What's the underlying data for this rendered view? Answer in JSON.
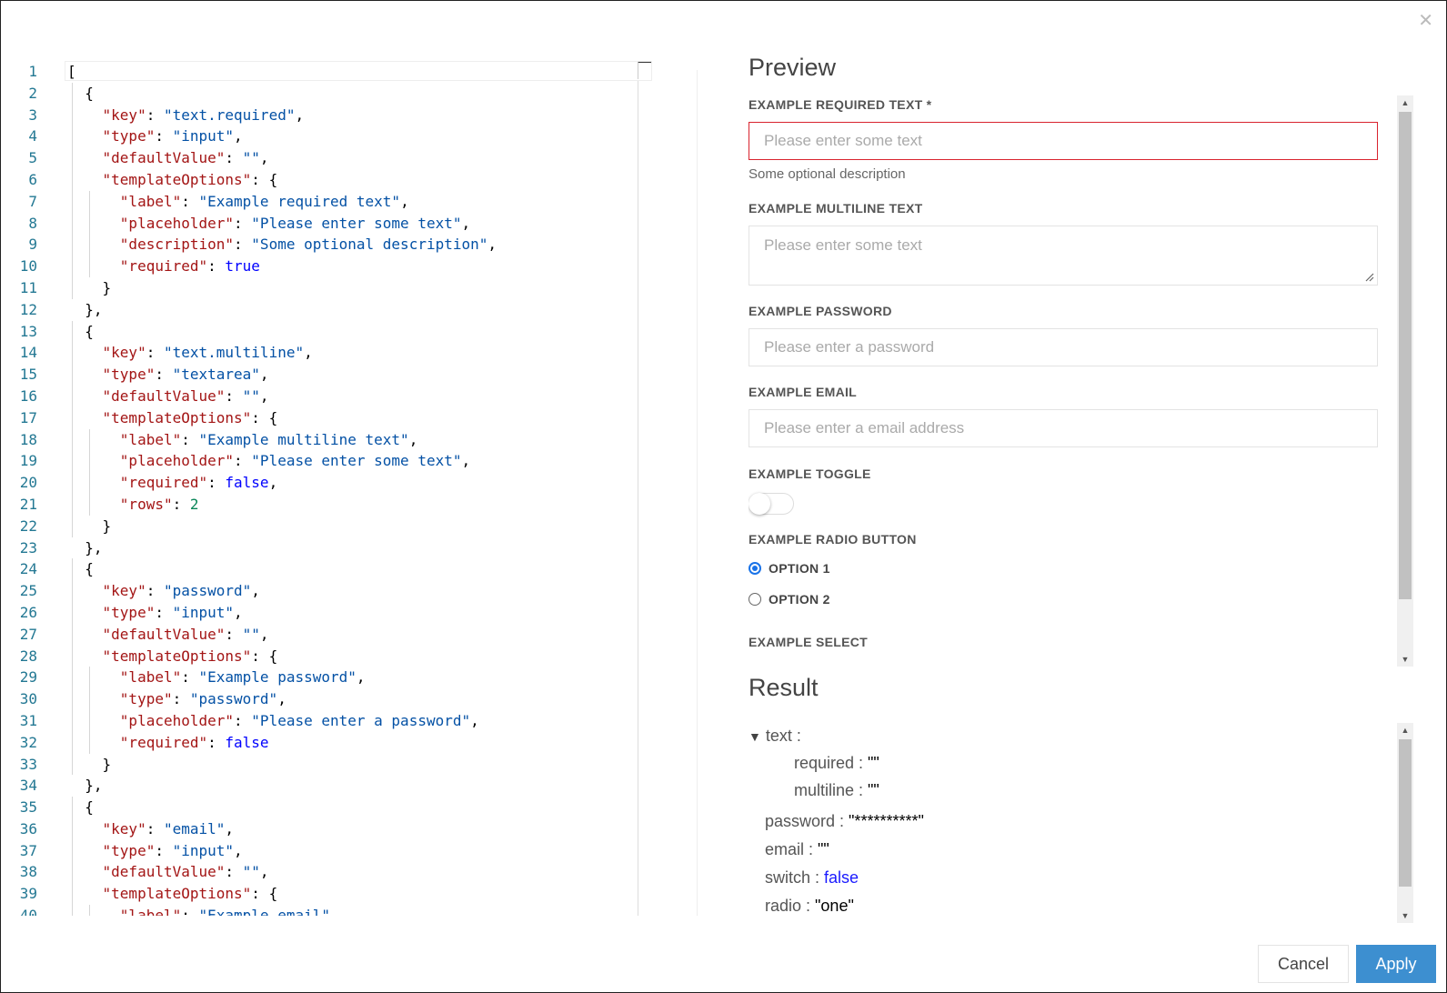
{
  "dialog": {
    "close_icon": "close-icon",
    "preview_title": "Preview",
    "result_title": "Result",
    "cancel_label": "Cancel",
    "apply_label": "Apply"
  },
  "editor": {
    "lines": [
      {
        "n": "1",
        "t": [
          [
            "p",
            "["
          ]
        ],
        "g": []
      },
      {
        "n": "2",
        "t": [
          [
            "p",
            "  {"
          ]
        ],
        "g": [
          0
        ]
      },
      {
        "n": "3",
        "t": [
          [
            "p",
            "    "
          ],
          [
            "k",
            "\"key\""
          ],
          [
            "p",
            ": "
          ],
          [
            "s",
            "\"text.required\""
          ],
          [
            "p",
            ","
          ]
        ],
        "g": [
          0
        ]
      },
      {
        "n": "4",
        "t": [
          [
            "p",
            "    "
          ],
          [
            "k",
            "\"type\""
          ],
          [
            "p",
            ": "
          ],
          [
            "s",
            "\"input\""
          ],
          [
            "p",
            ","
          ]
        ],
        "g": [
          0
        ]
      },
      {
        "n": "5",
        "t": [
          [
            "p",
            "    "
          ],
          [
            "k",
            "\"defaultValue\""
          ],
          [
            "p",
            ": "
          ],
          [
            "s",
            "\"\""
          ],
          [
            "p",
            ","
          ]
        ],
        "g": [
          0
        ]
      },
      {
        "n": "6",
        "t": [
          [
            "p",
            "    "
          ],
          [
            "k",
            "\"templateOptions\""
          ],
          [
            "p",
            ": {"
          ]
        ],
        "g": [
          0
        ]
      },
      {
        "n": "7",
        "t": [
          [
            "p",
            "      "
          ],
          [
            "k",
            "\"label\""
          ],
          [
            "p",
            ": "
          ],
          [
            "s",
            "\"Example required text\""
          ],
          [
            "p",
            ","
          ]
        ],
        "g": [
          0,
          1
        ]
      },
      {
        "n": "8",
        "t": [
          [
            "p",
            "      "
          ],
          [
            "k",
            "\"placeholder\""
          ],
          [
            "p",
            ": "
          ],
          [
            "s",
            "\"Please enter some text\""
          ],
          [
            "p",
            ","
          ]
        ],
        "g": [
          0,
          1
        ]
      },
      {
        "n": "9",
        "t": [
          [
            "p",
            "      "
          ],
          [
            "k",
            "\"description\""
          ],
          [
            "p",
            ": "
          ],
          [
            "s",
            "\"Some optional description\""
          ],
          [
            "p",
            ","
          ]
        ],
        "g": [
          0,
          1
        ]
      },
      {
        "n": "10",
        "t": [
          [
            "p",
            "      "
          ],
          [
            "k",
            "\"required\""
          ],
          [
            "p",
            ": "
          ],
          [
            "b",
            "true"
          ]
        ],
        "g": [
          0,
          1
        ]
      },
      {
        "n": "11",
        "t": [
          [
            "p",
            "    }"
          ]
        ],
        "g": [
          0
        ]
      },
      {
        "n": "12",
        "t": [
          [
            "p",
            "  },"
          ]
        ],
        "g": []
      },
      {
        "n": "13",
        "t": [
          [
            "p",
            "  {"
          ]
        ],
        "g": [
          0
        ]
      },
      {
        "n": "14",
        "t": [
          [
            "p",
            "    "
          ],
          [
            "k",
            "\"key\""
          ],
          [
            "p",
            ": "
          ],
          [
            "s",
            "\"text.multiline\""
          ],
          [
            "p",
            ","
          ]
        ],
        "g": [
          0
        ]
      },
      {
        "n": "15",
        "t": [
          [
            "p",
            "    "
          ],
          [
            "k",
            "\"type\""
          ],
          [
            "p",
            ": "
          ],
          [
            "s",
            "\"textarea\""
          ],
          [
            "p",
            ","
          ]
        ],
        "g": [
          0
        ]
      },
      {
        "n": "16",
        "t": [
          [
            "p",
            "    "
          ],
          [
            "k",
            "\"defaultValue\""
          ],
          [
            "p",
            ": "
          ],
          [
            "s",
            "\"\""
          ],
          [
            "p",
            ","
          ]
        ],
        "g": [
          0
        ]
      },
      {
        "n": "17",
        "t": [
          [
            "p",
            "    "
          ],
          [
            "k",
            "\"templateOptions\""
          ],
          [
            "p",
            ": {"
          ]
        ],
        "g": [
          0
        ]
      },
      {
        "n": "18",
        "t": [
          [
            "p",
            "      "
          ],
          [
            "k",
            "\"label\""
          ],
          [
            "p",
            ": "
          ],
          [
            "s",
            "\"Example multiline text\""
          ],
          [
            "p",
            ","
          ]
        ],
        "g": [
          0,
          1
        ]
      },
      {
        "n": "19",
        "t": [
          [
            "p",
            "      "
          ],
          [
            "k",
            "\"placeholder\""
          ],
          [
            "p",
            ": "
          ],
          [
            "s",
            "\"Please enter some text\""
          ],
          [
            "p",
            ","
          ]
        ],
        "g": [
          0,
          1
        ]
      },
      {
        "n": "20",
        "t": [
          [
            "p",
            "      "
          ],
          [
            "k",
            "\"required\""
          ],
          [
            "p",
            ": "
          ],
          [
            "b",
            "false"
          ],
          [
            "p",
            ","
          ]
        ],
        "g": [
          0,
          1
        ]
      },
      {
        "n": "21",
        "t": [
          [
            "p",
            "      "
          ],
          [
            "k",
            "\"rows\""
          ],
          [
            "p",
            ": "
          ],
          [
            "n",
            "2"
          ]
        ],
        "g": [
          0,
          1
        ]
      },
      {
        "n": "22",
        "t": [
          [
            "p",
            "    }"
          ]
        ],
        "g": [
          0
        ]
      },
      {
        "n": "23",
        "t": [
          [
            "p",
            "  },"
          ]
        ],
        "g": []
      },
      {
        "n": "24",
        "t": [
          [
            "p",
            "  {"
          ]
        ],
        "g": [
          0
        ]
      },
      {
        "n": "25",
        "t": [
          [
            "p",
            "    "
          ],
          [
            "k",
            "\"key\""
          ],
          [
            "p",
            ": "
          ],
          [
            "s",
            "\"password\""
          ],
          [
            "p",
            ","
          ]
        ],
        "g": [
          0
        ]
      },
      {
        "n": "26",
        "t": [
          [
            "p",
            "    "
          ],
          [
            "k",
            "\"type\""
          ],
          [
            "p",
            ": "
          ],
          [
            "s",
            "\"input\""
          ],
          [
            "p",
            ","
          ]
        ],
        "g": [
          0
        ]
      },
      {
        "n": "27",
        "t": [
          [
            "p",
            "    "
          ],
          [
            "k",
            "\"defaultValue\""
          ],
          [
            "p",
            ": "
          ],
          [
            "s",
            "\"\""
          ],
          [
            "p",
            ","
          ]
        ],
        "g": [
          0
        ]
      },
      {
        "n": "28",
        "t": [
          [
            "p",
            "    "
          ],
          [
            "k",
            "\"templateOptions\""
          ],
          [
            "p",
            ": {"
          ]
        ],
        "g": [
          0
        ]
      },
      {
        "n": "29",
        "t": [
          [
            "p",
            "      "
          ],
          [
            "k",
            "\"label\""
          ],
          [
            "p",
            ": "
          ],
          [
            "s",
            "\"Example password\""
          ],
          [
            "p",
            ","
          ]
        ],
        "g": [
          0,
          1
        ]
      },
      {
        "n": "30",
        "t": [
          [
            "p",
            "      "
          ],
          [
            "k",
            "\"type\""
          ],
          [
            "p",
            ": "
          ],
          [
            "s",
            "\"password\""
          ],
          [
            "p",
            ","
          ]
        ],
        "g": [
          0,
          1
        ]
      },
      {
        "n": "31",
        "t": [
          [
            "p",
            "      "
          ],
          [
            "k",
            "\"placeholder\""
          ],
          [
            "p",
            ": "
          ],
          [
            "s",
            "\"Please enter a password\""
          ],
          [
            "p",
            ","
          ]
        ],
        "g": [
          0,
          1
        ]
      },
      {
        "n": "32",
        "t": [
          [
            "p",
            "      "
          ],
          [
            "k",
            "\"required\""
          ],
          [
            "p",
            ": "
          ],
          [
            "b",
            "false"
          ]
        ],
        "g": [
          0,
          1
        ]
      },
      {
        "n": "33",
        "t": [
          [
            "p",
            "    }"
          ]
        ],
        "g": [
          0
        ]
      },
      {
        "n": "34",
        "t": [
          [
            "p",
            "  },"
          ]
        ],
        "g": []
      },
      {
        "n": "35",
        "t": [
          [
            "p",
            "  {"
          ]
        ],
        "g": [
          0
        ]
      },
      {
        "n": "36",
        "t": [
          [
            "p",
            "    "
          ],
          [
            "k",
            "\"key\""
          ],
          [
            "p",
            ": "
          ],
          [
            "s",
            "\"email\""
          ],
          [
            "p",
            ","
          ]
        ],
        "g": [
          0
        ]
      },
      {
        "n": "37",
        "t": [
          [
            "p",
            "    "
          ],
          [
            "k",
            "\"type\""
          ],
          [
            "p",
            ": "
          ],
          [
            "s",
            "\"input\""
          ],
          [
            "p",
            ","
          ]
        ],
        "g": [
          0
        ]
      },
      {
        "n": "38",
        "t": [
          [
            "p",
            "    "
          ],
          [
            "k",
            "\"defaultValue\""
          ],
          [
            "p",
            ": "
          ],
          [
            "s",
            "\"\""
          ],
          [
            "p",
            ","
          ]
        ],
        "g": [
          0
        ]
      },
      {
        "n": "39",
        "t": [
          [
            "p",
            "    "
          ],
          [
            "k",
            "\"templateOptions\""
          ],
          [
            "p",
            ": {"
          ]
        ],
        "g": [
          0
        ]
      },
      {
        "n": "40",
        "t": [
          [
            "p",
            "      "
          ],
          [
            "k",
            "\"label\""
          ],
          [
            "p",
            ": "
          ],
          [
            "s",
            "\"Example email\""
          ]
        ],
        "g": [
          0,
          1
        ]
      }
    ]
  },
  "preview": {
    "required_text": {
      "label": "EXAMPLE REQUIRED TEXT *",
      "placeholder": "Please enter some text",
      "description": "Some optional description"
    },
    "multiline_text": {
      "label": "EXAMPLE MULTILINE TEXT",
      "placeholder": "Please enter some text"
    },
    "password": {
      "label": "EXAMPLE PASSWORD",
      "placeholder": "Please enter a password"
    },
    "email": {
      "label": "EXAMPLE EMAIL",
      "placeholder": "Please enter a email address"
    },
    "toggle": {
      "label": "EXAMPLE TOGGLE",
      "checked": false
    },
    "radio": {
      "label": "EXAMPLE RADIO BUTTON",
      "options": [
        {
          "label": "OPTION 1",
          "checked": true
        },
        {
          "label": "OPTION 2",
          "checked": false
        }
      ]
    },
    "select": {
      "label": "EXAMPLE SELECT"
    }
  },
  "result": {
    "expand_icon": "triangle-down-icon",
    "text_key": "text :",
    "required_key": "required : ",
    "required_val": "\"\"",
    "multiline_key": "multiline : ",
    "multiline_val": "\"\"",
    "password_key": "password : ",
    "password_val": "\"**********\"",
    "email_key": "email : ",
    "email_val": "\"\"",
    "switch_key": "switch : ",
    "switch_val": "false",
    "radio_key": "radio : ",
    "radio_val": "\"one\""
  },
  "colors": {
    "error_border": "#d9232e",
    "apply_bg": "#3d8fd0",
    "radio_accent": "#1a73e8"
  }
}
